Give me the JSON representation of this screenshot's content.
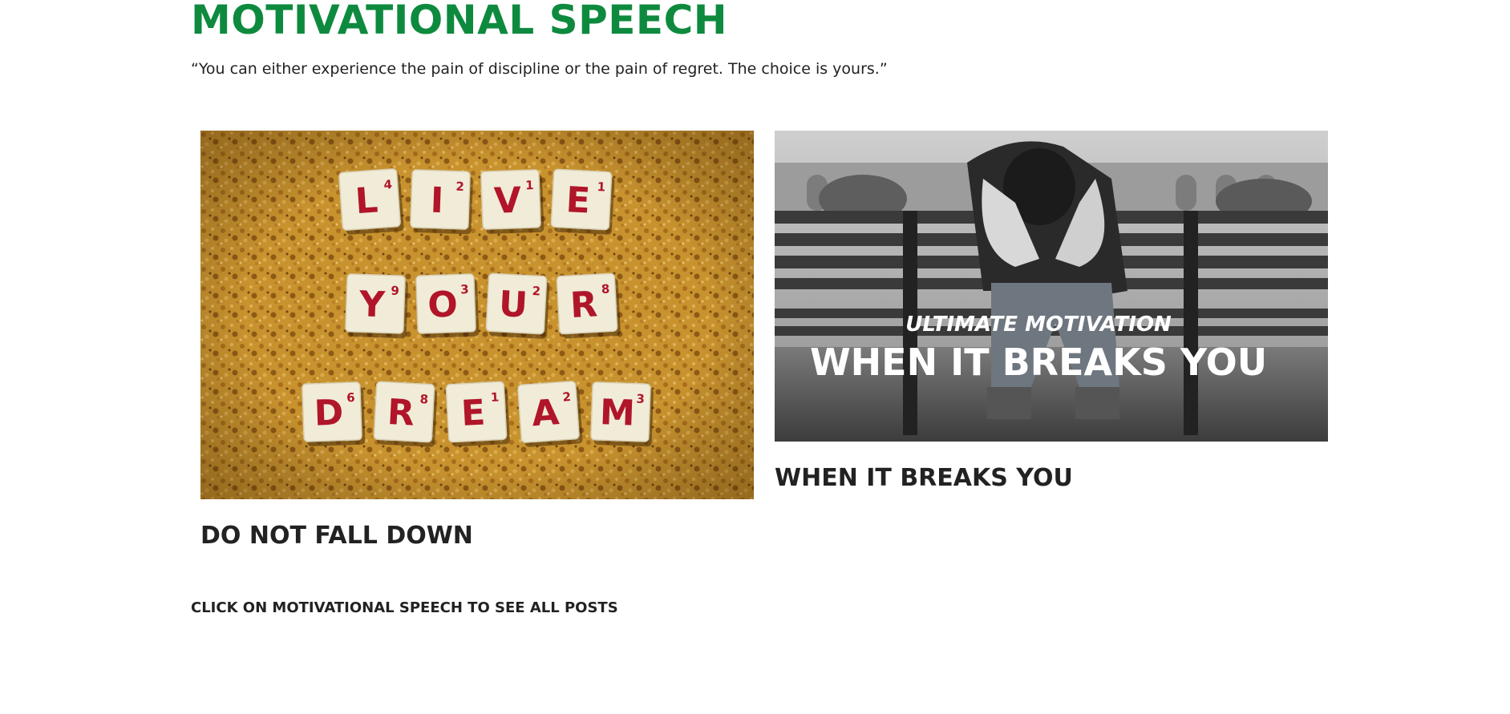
{
  "section": {
    "title": "MOTIVATIONAL SPEECH",
    "quote": "“You can either experience the pain of discipline or the pain of regret. The choice is yours.”"
  },
  "posts": [
    {
      "title": "DO NOT FALL DOWN",
      "image_tiles": {
        "row1": [
          "L",
          "I",
          "V",
          "E"
        ],
        "row1_scores": [
          "4",
          "2",
          "1",
          "1"
        ],
        "row2": [
          "Y",
          "O",
          "U",
          "R"
        ],
        "row2_scores": [
          "9",
          "3",
          "2",
          "8"
        ],
        "row3": [
          "D",
          "R",
          "E",
          "A",
          "M"
        ],
        "row3_scores": [
          "6",
          "8",
          "1",
          "2",
          "3"
        ]
      }
    },
    {
      "title": "WHEN IT BREAKS YOU",
      "image_caption_small": "ULTIMATE MOTIVATION",
      "image_caption_large": "WHEN IT BREAKS YOU"
    }
  ],
  "footer": {
    "link_text": "CLICK ON MOTIVATIONAL SPEECH TO SEE ALL POSTS"
  },
  "colors": {
    "accent": "#0e8a3e",
    "text": "#222222",
    "cork": "#c8922e",
    "tile": "#f1ecd8",
    "tile_letter": "#b0152a"
  }
}
